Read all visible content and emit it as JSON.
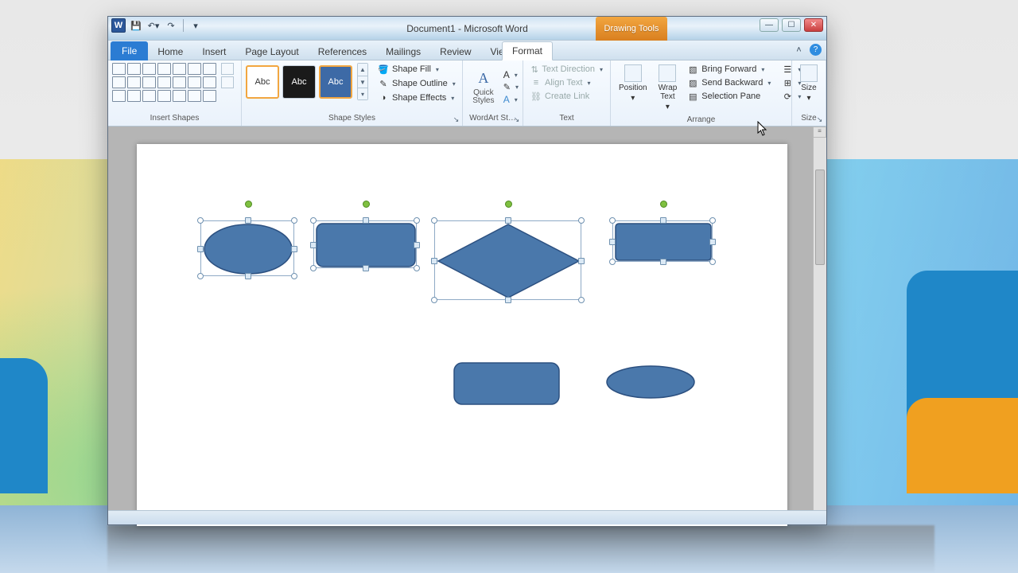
{
  "window": {
    "title": "Document1 - Microsoft Word",
    "app_letter": "W"
  },
  "contextual_tab": {
    "label": "Drawing Tools"
  },
  "qat": {
    "save": "💾",
    "undo": "↶",
    "redo": "↷"
  },
  "tabs": {
    "file": "File",
    "home": "Home",
    "insert": "Insert",
    "page_layout": "Page Layout",
    "references": "References",
    "mailings": "Mailings",
    "review": "Review",
    "view": "View",
    "format": "Format"
  },
  "ribbon": {
    "insert_shapes": {
      "label": "Insert Shapes"
    },
    "shape_styles": {
      "label": "Shape Styles",
      "swatch_text": "Abc",
      "shape_fill": "Shape Fill",
      "shape_outline": "Shape Outline",
      "shape_effects": "Shape Effects"
    },
    "wordart": {
      "label": "WordArt St…",
      "quick_styles": "Quick Styles"
    },
    "text": {
      "label": "Text",
      "text_direction": "Text Direction",
      "align_text": "Align Text",
      "create_link": "Create Link"
    },
    "arrange": {
      "label": "Arrange",
      "position": "Position",
      "wrap_text": "Wrap Text",
      "bring_forward": "Bring Forward",
      "send_backward": "Send Backward",
      "selection_pane": "Selection Pane"
    },
    "size": {
      "label": "Size"
    }
  }
}
